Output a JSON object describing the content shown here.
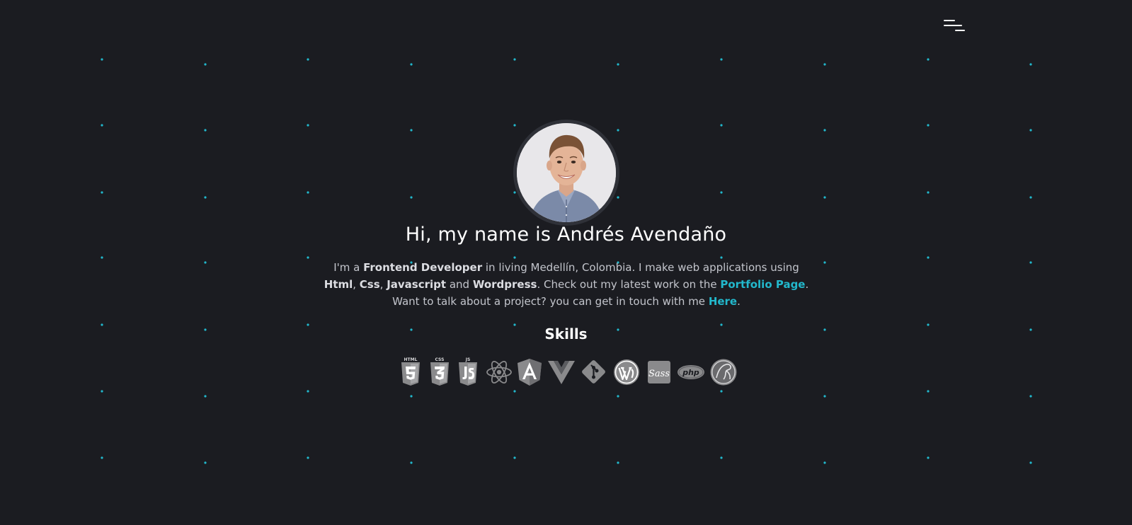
{
  "header": {
    "menu_icon": "hamburger-menu-icon"
  },
  "hero": {
    "avatar_alt": "profile-photo",
    "title": "Hi, my name is Andrés Avendaño",
    "intro": {
      "t1": "I'm a ",
      "role": "Frontend Developer",
      "t2": " in living Medellín, Colombia. I make web applications using ",
      "html": "Html",
      "sep1": ", ",
      "css": "Css",
      "sep2": ", ",
      "js": "Javascript",
      "t3": " and ",
      "wp": "Wordpress",
      "t4": ". Check out my latest work on the ",
      "portfolio_link": "Portfolio Page",
      "t5": ".",
      "t6": "Want to talk about a project? you can get in touch with me ",
      "here_link": "Here",
      "t7": "."
    }
  },
  "skills": {
    "title": "Skills",
    "icons": [
      {
        "name": "html5-icon",
        "label": "HTML"
      },
      {
        "name": "css3-icon",
        "label": "CSS"
      },
      {
        "name": "javascript-icon",
        "label": "JS"
      },
      {
        "name": "react-icon"
      },
      {
        "name": "angular-icon"
      },
      {
        "name": "vue-icon"
      },
      {
        "name": "git-icon"
      },
      {
        "name": "wordpress-icon"
      },
      {
        "name": "sass-icon",
        "label": "Sass"
      },
      {
        "name": "php-icon",
        "label": "php"
      },
      {
        "name": "mysql-icon"
      }
    ]
  },
  "colors": {
    "background": "#1b1c21",
    "accent": "#22b8cc",
    "dot": "#22b8cc",
    "icon_gray": "#8a8a8c"
  }
}
